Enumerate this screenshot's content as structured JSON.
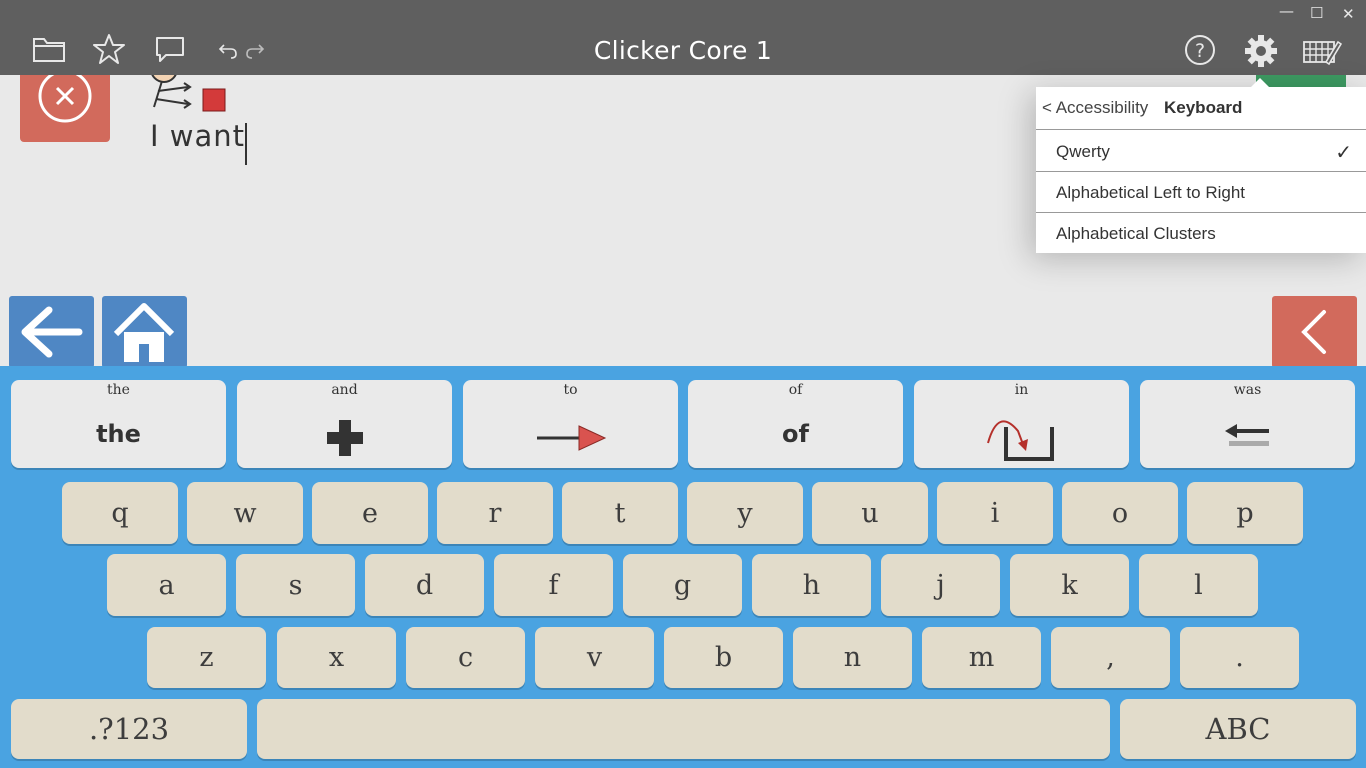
{
  "window": {
    "title": "Clicker Core 1",
    "controls": {
      "minimize": "—",
      "maximize": "☐",
      "close": "✕"
    }
  },
  "toolbar": {
    "left_icons": [
      "folder-icon",
      "star-icon",
      "speech-bubble-icon",
      "undo-icon",
      "redo-icon"
    ],
    "right_icons": [
      "help-icon",
      "gear-icon",
      "keyboard-edit-icon"
    ],
    "help_glyph": "?"
  },
  "writing": {
    "text": "I want"
  },
  "word_keys": [
    {
      "label": "the",
      "main": "the",
      "symbol": "text"
    },
    {
      "label": "and",
      "main": "",
      "symbol": "plus-icon"
    },
    {
      "label": "to",
      "main": "",
      "symbol": "arrow-right-icon"
    },
    {
      "label": "of",
      "main": "of",
      "symbol": "text"
    },
    {
      "label": "in",
      "main": "",
      "symbol": "into-box-icon"
    },
    {
      "label": "was",
      "main": "",
      "symbol": "past-arrow-icon"
    }
  ],
  "keyboard": {
    "row1": [
      "q",
      "w",
      "e",
      "r",
      "t",
      "y",
      "u",
      "i",
      "o",
      "p"
    ],
    "row2": [
      "a",
      "s",
      "d",
      "f",
      "g",
      "h",
      "j",
      "k",
      "l"
    ],
    "row3": [
      "z",
      "x",
      "c",
      "v",
      "b",
      "n",
      "m",
      ",",
      "."
    ],
    "numbers_key": ".?123",
    "abc_key": "ABC"
  },
  "menu": {
    "back_label": "< Accessibility",
    "title": "Keyboard",
    "items": [
      {
        "label": "Qwerty",
        "checked": true,
        "check": "✓"
      },
      {
        "label": "Alphabetical Left to Right",
        "checked": false,
        "check": ""
      },
      {
        "label": "Alphabetical Clusters",
        "checked": false,
        "check": ""
      }
    ]
  },
  "colors": {
    "topbar": "#5f5f5f",
    "keyboard_bg": "#4aa3e1",
    "key": "#e2dccb",
    "nav_blue": "#4f87c4",
    "nav_red": "#d26a5c"
  }
}
